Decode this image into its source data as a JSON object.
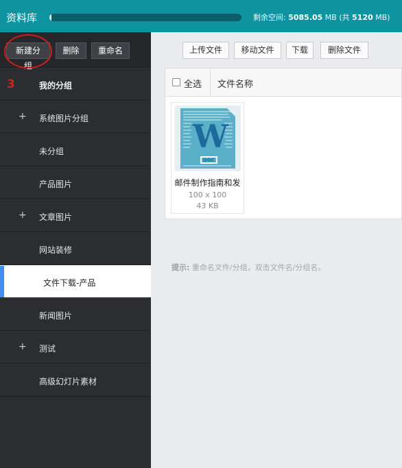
{
  "header": {
    "title": "资料库",
    "storage_prefix": "剩余空间: ",
    "storage_free": "5085.05",
    "storage_unit": " MB (共 ",
    "storage_total": "5120",
    "storage_suffix": " MB)",
    "usage_fraction": 0.007
  },
  "sidebar": {
    "toolbar": {
      "new_group": "新建分组",
      "delete": "删除",
      "rename": "重命名"
    },
    "annotation_number": "3",
    "items": [
      {
        "label": "我的分组",
        "plus": ""
      },
      {
        "label": "系统图片分组",
        "plus": "+"
      },
      {
        "label": "未分组",
        "plus": ""
      },
      {
        "label": "产品图片",
        "plus": ""
      },
      {
        "label": "文章图片",
        "plus": "+"
      },
      {
        "label": "网站装修",
        "plus": ""
      },
      {
        "label": "文件下载-产品",
        "plus": ""
      },
      {
        "label": "新闻图片",
        "plus": ""
      },
      {
        "label": "测试",
        "plus": "+"
      },
      {
        "label": "高级幻灯片素材",
        "plus": ""
      }
    ]
  },
  "main": {
    "toolbar": {
      "upload": "上传文件",
      "move": "移动文件",
      "download": "下载",
      "delete": "删除文件"
    },
    "table": {
      "select_all": "全选",
      "column_name": "文件名称"
    },
    "files": [
      {
        "name": "邮件制作指南和发",
        "dimensions": "100 x 100",
        "size": "43 KB",
        "icon_text": "W",
        "tag": "DOC"
      }
    ],
    "hint_label": "提示:",
    "hint_text": " 重命名文件/分组，双击文件名/分组名。"
  },
  "colors": {
    "header_bg": "#0e93a0",
    "sidebar_bg": "#2b2d31",
    "active_accent": "#3f8ef0",
    "annotation_red": "#cc1f1f"
  }
}
